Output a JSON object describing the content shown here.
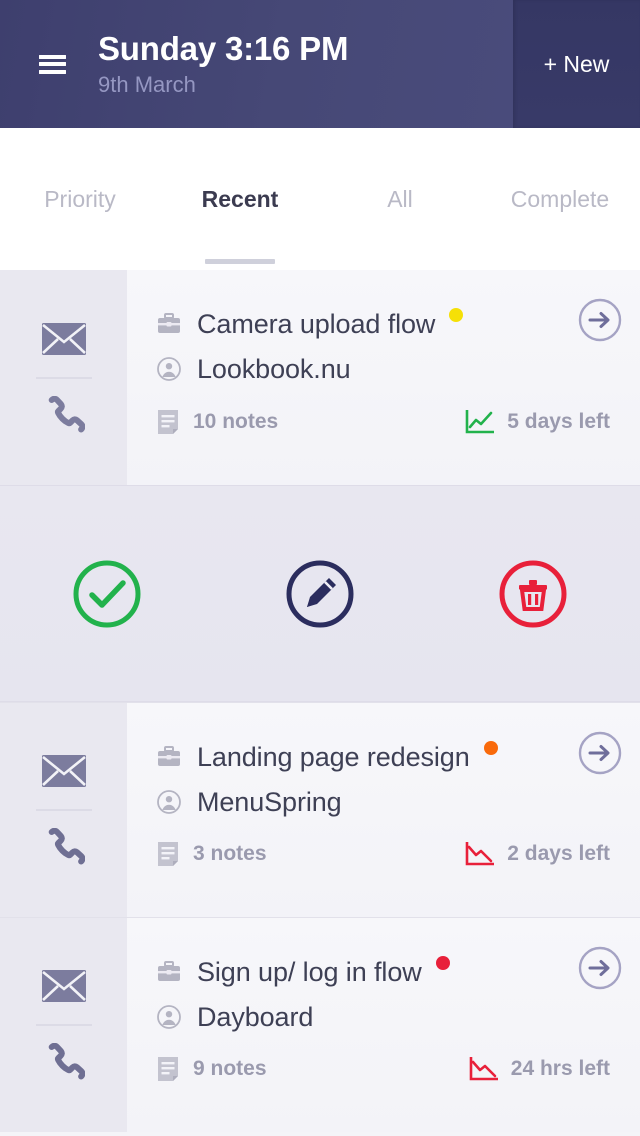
{
  "header": {
    "menu_icon": "hamburger-icon",
    "title": "Sunday 3:16 PM",
    "subtitle": "9th March",
    "new_label": "+ New"
  },
  "tabs": [
    {
      "label": "Priority",
      "active": false
    },
    {
      "label": "Recent",
      "active": true
    },
    {
      "label": "All",
      "active": false
    },
    {
      "label": "Complete",
      "active": false
    }
  ],
  "rail": {
    "mail_icon": "mail-icon",
    "phone_icon": "phone-icon"
  },
  "actions": [
    {
      "name": "complete-action",
      "icon": "check-circle-icon",
      "color": "#22b24c"
    },
    {
      "name": "edit-action",
      "icon": "pencil-circle-icon",
      "color": "#2b2d5e"
    },
    {
      "name": "delete-action",
      "icon": "trash-circle-icon",
      "color": "#e8203a"
    }
  ],
  "cards": [
    {
      "title": "Camera upload flow",
      "company": "Lookbook.nu",
      "dot_color": "#f5e007",
      "notes": "10 notes",
      "due": "5 days left",
      "trend": "up",
      "trend_color": "#22b24c",
      "project_icon": "briefcase-icon",
      "company_icon": "person-circle-icon",
      "notes_icon": "notes-icon",
      "trend_icon": "trend-up-icon",
      "go_icon": "arrow-right-circle-icon"
    },
    {
      "title": "Landing page redesign",
      "company": "MenuSpring",
      "dot_color": "#f96a0b",
      "notes": "3 notes",
      "due": "2 days left",
      "trend": "down",
      "trend_color": "#e8203a",
      "project_icon": "briefcase-icon",
      "company_icon": "person-circle-icon",
      "notes_icon": "notes-icon",
      "trend_icon": "trend-down-icon",
      "go_icon": "arrow-right-circle-icon"
    },
    {
      "title": "Sign up/ log in flow",
      "company": "Dayboard",
      "dot_color": "#e8203a",
      "notes": "9 notes",
      "due": "24 hrs left",
      "trend": "down",
      "trend_color": "#e8203a",
      "project_icon": "briefcase-icon",
      "company_icon": "person-circle-icon",
      "notes_icon": "notes-icon",
      "trend_icon": "trend-down-icon",
      "go_icon": "arrow-right-circle-icon"
    }
  ]
}
